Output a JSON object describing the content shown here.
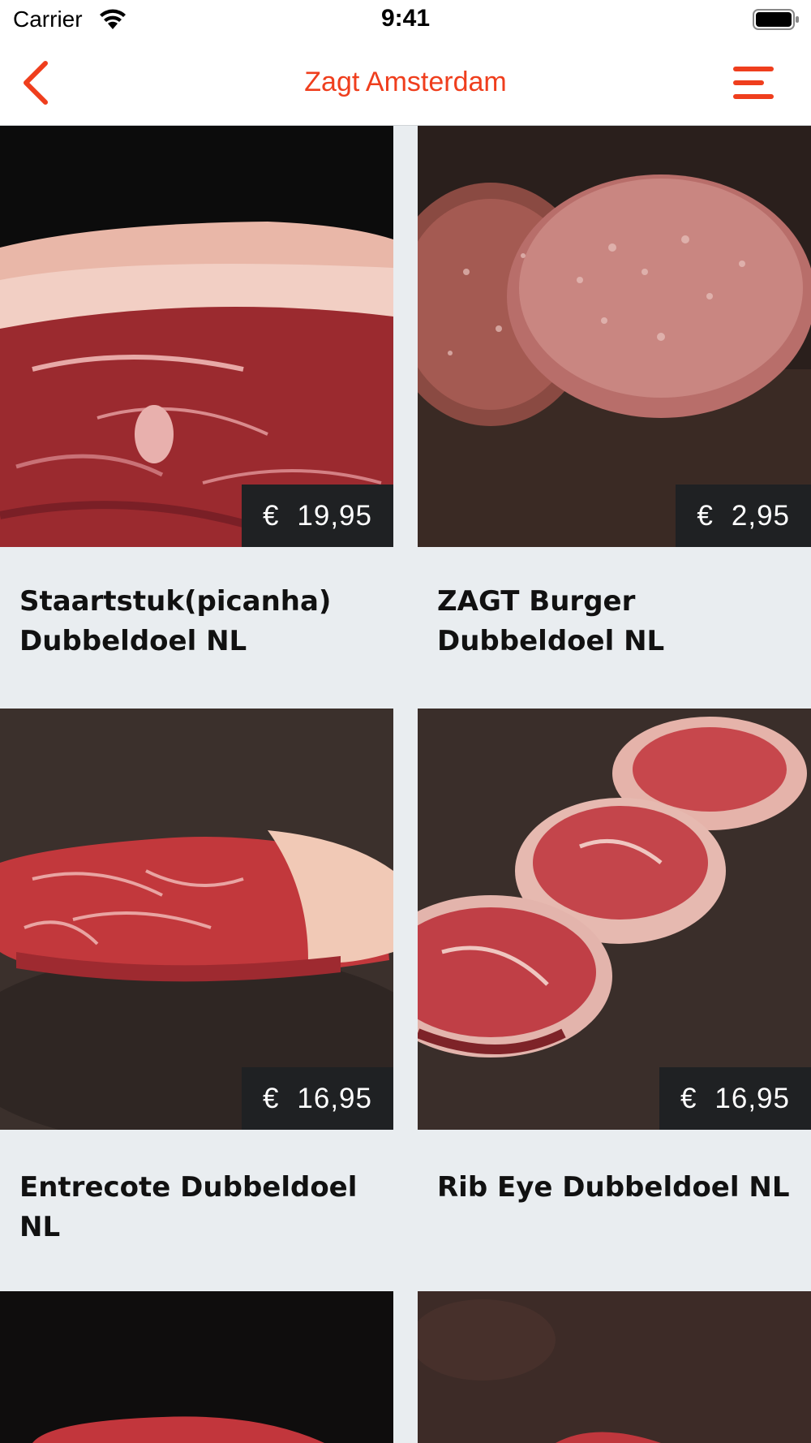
{
  "status_bar": {
    "carrier": "Carrier",
    "time": "9:41"
  },
  "nav": {
    "title": "Zagt Amsterdam",
    "back_icon": "chevron-left-icon",
    "menu_icon": "hamburger-menu-icon"
  },
  "colors": {
    "accent": "#ef3e1d",
    "price_bg": "#1f2123",
    "page_bg": "#e9edf0"
  },
  "products": [
    {
      "name": "Staartstuk(picanha) Dubbeldoel NL",
      "currency": "€",
      "price": "19,95"
    },
    {
      "name": "ZAGT Burger Dubbeldoel NL",
      "currency": "€",
      "price": "2,95"
    },
    {
      "name": "Entrecote Dubbeldoel NL",
      "currency": "€",
      "price": "16,95"
    },
    {
      "name": "Rib Eye Dubbeldoel NL",
      "currency": "€",
      "price": "16,95"
    }
  ]
}
